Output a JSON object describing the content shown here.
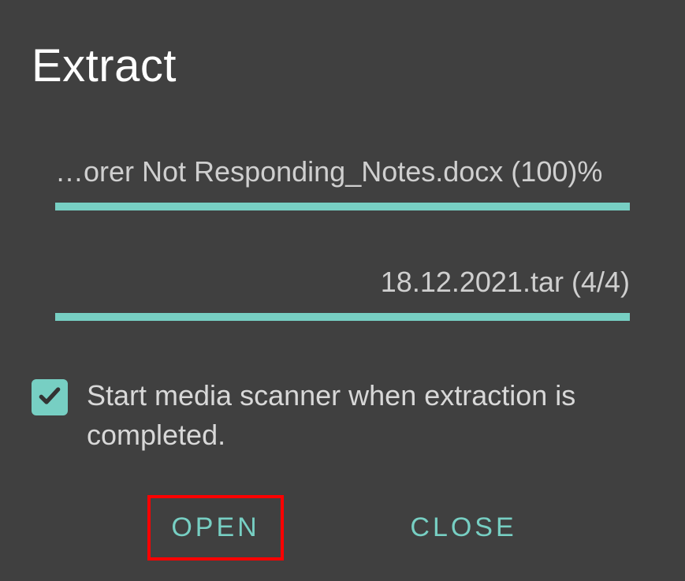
{
  "dialog": {
    "title": "Extract",
    "file_progress": {
      "label": "…orer Not Responding_Notes.docx (100)%",
      "percent": 100
    },
    "archive_progress": {
      "label": "18.12.2021.tar (4/4)",
      "current": 4,
      "total": 4
    },
    "checkbox": {
      "checked": true,
      "label": "Start media scanner when extraction is completed."
    },
    "buttons": {
      "open": "OPEN",
      "close": "CLOSE"
    }
  },
  "colors": {
    "accent": "#77CFC3",
    "background": "#404040",
    "text": "#d8d8d8",
    "highlight": "#ff0000"
  }
}
